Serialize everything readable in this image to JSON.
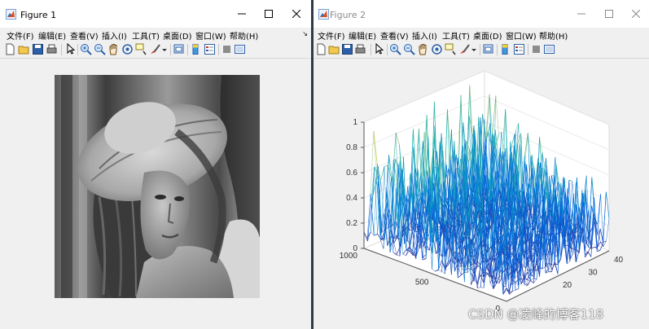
{
  "figure1": {
    "title": "Figure 1",
    "menus": [
      "文件(F)",
      "编辑(E)",
      "查看(V)",
      "插入(I)",
      "工具(T)",
      "桌面(D)",
      "窗口(W)",
      "帮助(H)"
    ],
    "dock_arrow": "↘",
    "image_icon": "grayscale-portrait-image"
  },
  "figure2": {
    "title": "Figure 2",
    "menus": [
      "文件(F)",
      "编辑(E)",
      "查看(V)",
      "插入(I)",
      "工具(T)",
      "桌面(D)",
      "窗口(W)",
      "帮助(H)"
    ],
    "plot": {
      "z_ticks": [
        "0",
        "0.2",
        "0.4",
        "0.6",
        "0.8",
        "1"
      ],
      "y_ticks": [
        "0",
        "500",
        "1000"
      ],
      "x_ticks": [
        "20",
        "30",
        "40"
      ]
    }
  },
  "chart_data": {
    "type": "surface",
    "title": "",
    "xlabel": "",
    "ylabel": "",
    "zlabel": "",
    "xlim": [
      0,
      40
    ],
    "ylim": [
      0,
      1000
    ],
    "zlim": [
      0,
      1
    ],
    "z_ticks": [
      0,
      0.2,
      0.4,
      0.6,
      0.8,
      1
    ],
    "y_ticks": [
      0,
      500,
      1000
    ],
    "x_ticks": [
      20,
      30,
      40
    ],
    "grid": true,
    "colormap": "parula"
  },
  "watermark": "CSDN @凌峰的博客118",
  "colors": {
    "titlebar": "#ffffff",
    "menubar": "#f0f0f0",
    "separator": "#2f3a48"
  }
}
